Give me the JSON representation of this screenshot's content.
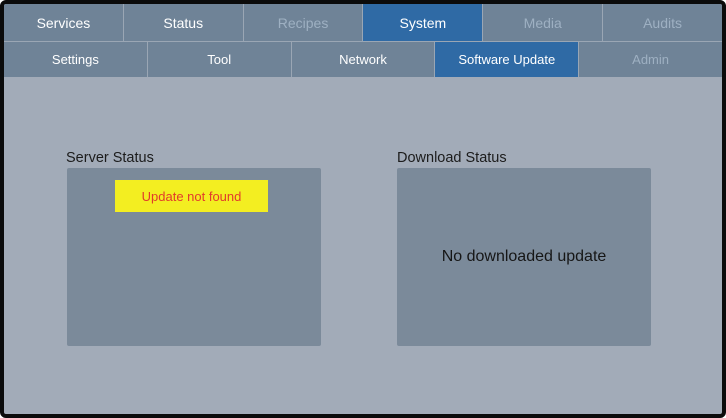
{
  "main_tabs": [
    {
      "label": "Services",
      "state": "enabled"
    },
    {
      "label": "Status",
      "state": "enabled"
    },
    {
      "label": "Recipes",
      "state": "disabled"
    },
    {
      "label": "System",
      "state": "active"
    },
    {
      "label": "Media",
      "state": "disabled"
    },
    {
      "label": "Audits",
      "state": "disabled"
    }
  ],
  "sub_tabs": [
    {
      "label": "Settings",
      "state": "enabled"
    },
    {
      "label": "Tool",
      "state": "enabled"
    },
    {
      "label": "Network",
      "state": "enabled"
    },
    {
      "label": "Software Update",
      "state": "active"
    },
    {
      "label": "Admin",
      "state": "disabled"
    }
  ],
  "server_status": {
    "title": "Server Status",
    "message": "Update not found"
  },
  "download_status": {
    "title": "Download Status",
    "message": "No downloaded update"
  },
  "colors": {
    "background": "#a2abb8",
    "tab": "#6f8397",
    "tab_active": "#2f6aa5",
    "panel": "#7b8a9a",
    "warning_bg": "#f3ee21",
    "warning_text": "#e23b2b"
  }
}
